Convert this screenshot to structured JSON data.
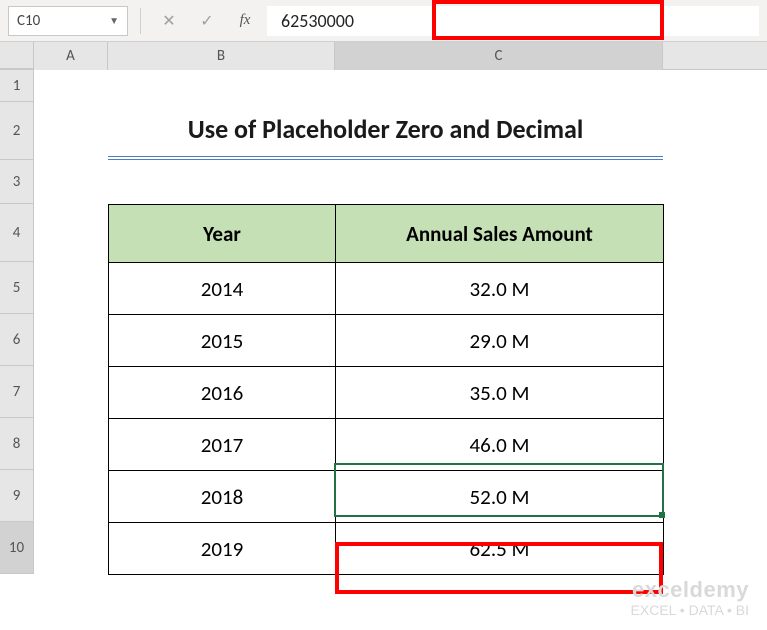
{
  "name_box": "C10",
  "formula_value": "62530000",
  "fx_label": "fx",
  "col_headers": {
    "A": "A",
    "B": "B",
    "C": "C"
  },
  "row_headers": {
    "r1": "1",
    "r2": "2",
    "r3": "3",
    "r4": "4",
    "r5": "5",
    "r6": "6",
    "r7": "7",
    "r8": "8",
    "r9": "9",
    "r10": "10"
  },
  "title": "Use of Placeholder Zero and Decimal",
  "table": {
    "headers": {
      "year": "Year",
      "amount": "Annual Sales Amount"
    },
    "rows": [
      {
        "year": "2014",
        "amount": "32.0 M"
      },
      {
        "year": "2015",
        "amount": "29.0 M"
      },
      {
        "year": "2016",
        "amount": "35.0 M"
      },
      {
        "year": "2017",
        "amount": "46.0 M"
      },
      {
        "year": "2018",
        "amount": "52.0 M"
      },
      {
        "year": "2019",
        "amount": "62.5 M"
      }
    ]
  },
  "watermark": {
    "brand": "exceldemy",
    "tagline": "EXCEL  •  DATA  •  BI"
  }
}
